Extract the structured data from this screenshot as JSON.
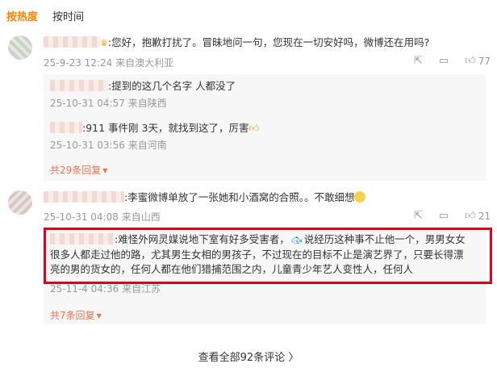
{
  "sort_tabs": [
    {
      "label": "按热度",
      "active": true
    },
    {
      "label": "按时间",
      "active": false
    }
  ],
  "comments": [
    {
      "text": ":您好，抱歉打扰了。冒昧地问一句，您现在一切安好吗，微博还在用吗?",
      "time": "25-9-23 12:24",
      "source": "来自澳大利亚",
      "likes": "77",
      "replies": [
        {
          "text": ":提到的这几个名字 人都没了",
          "time": "25-10-31 04:57",
          "source": "来自陕西"
        },
        {
          "text": ":911 事件刚 3天，就找到这了，厉害",
          "time": "25-10-31 03:56",
          "source": "来自河南"
        }
      ],
      "more_replies": "共29条回复"
    },
    {
      "text": ":李蜜微博单放了一张她和小酒窝的合照。。不敢细想",
      "time": "25-10-31 04:08",
      "source": "来自山西",
      "likes": "21",
      "replies": [
        {
          "line1a": ":难怪外网灵媒说地下室有好多受害者，",
          "line1b": "说经历这种事不止他一个，男男女女",
          "line2": "很多人都走过他的路，尤其男生女相的男孩子，不过现在的目标不止是演艺界了，只要长得漂",
          "line3": "亮的男的货女的，任何人都在他们猎捕范围之内，儿童青少年艺人变性人，任何人",
          "time": "25-11-4 04:36",
          "source": "来自江苏"
        }
      ],
      "more_replies": "共7条回复"
    }
  ],
  "view_all": "查看全部92条评论 〉",
  "colors": {
    "accent": "#ff8200",
    "link": "#eb7350",
    "highlight": "#e0001b",
    "meta": "#999999"
  },
  "icons": [
    "share-icon",
    "comment-icon",
    "like-icon",
    "crown-icon",
    "thumb-icon",
    "fish-emoji",
    "grin-emoji"
  ]
}
